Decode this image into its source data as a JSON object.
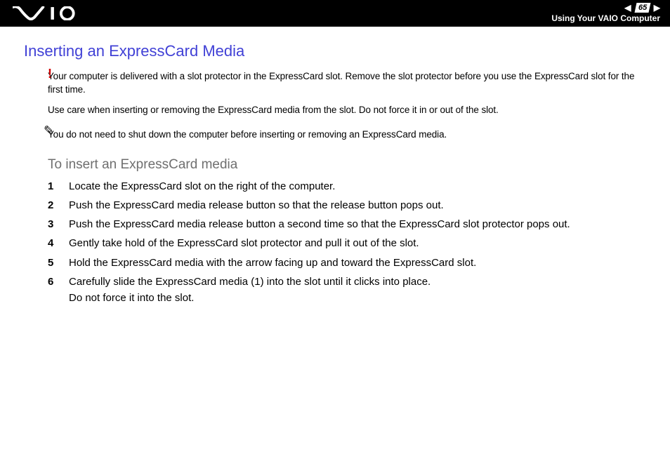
{
  "header": {
    "page_number": "65",
    "section": "Using Your VAIO Computer"
  },
  "title": "Inserting an ExpressCard Media",
  "warning": {
    "line1": "Your computer is delivered with a slot protector in the ExpressCard slot. Remove the slot protector before you use the ExpressCard slot for the first time.",
    "line2": "Use care when inserting or removing the ExpressCard media from the slot. Do not force it in or out of the slot."
  },
  "tip": {
    "text": "You do not need to shut down the computer before inserting or removing an ExpressCard media."
  },
  "subheading": "To insert an ExpressCard media",
  "steps": [
    {
      "n": "1",
      "t": "Locate the ExpressCard slot on the right of the computer."
    },
    {
      "n": "2",
      "t": "Push the ExpressCard media release button so that the release button pops out."
    },
    {
      "n": "3",
      "t": "Push the ExpressCard media release button a second time so that the ExpressCard slot protector pops out."
    },
    {
      "n": "4",
      "t": "Gently take hold of the ExpressCard slot protector and pull it out of the slot."
    },
    {
      "n": "5",
      "t": "Hold the ExpressCard media with the arrow facing up and toward the ExpressCard slot."
    },
    {
      "n": "6",
      "t": "Carefully slide the ExpressCard media (1) into the slot until it clicks into place.\nDo not force it into the slot."
    }
  ]
}
